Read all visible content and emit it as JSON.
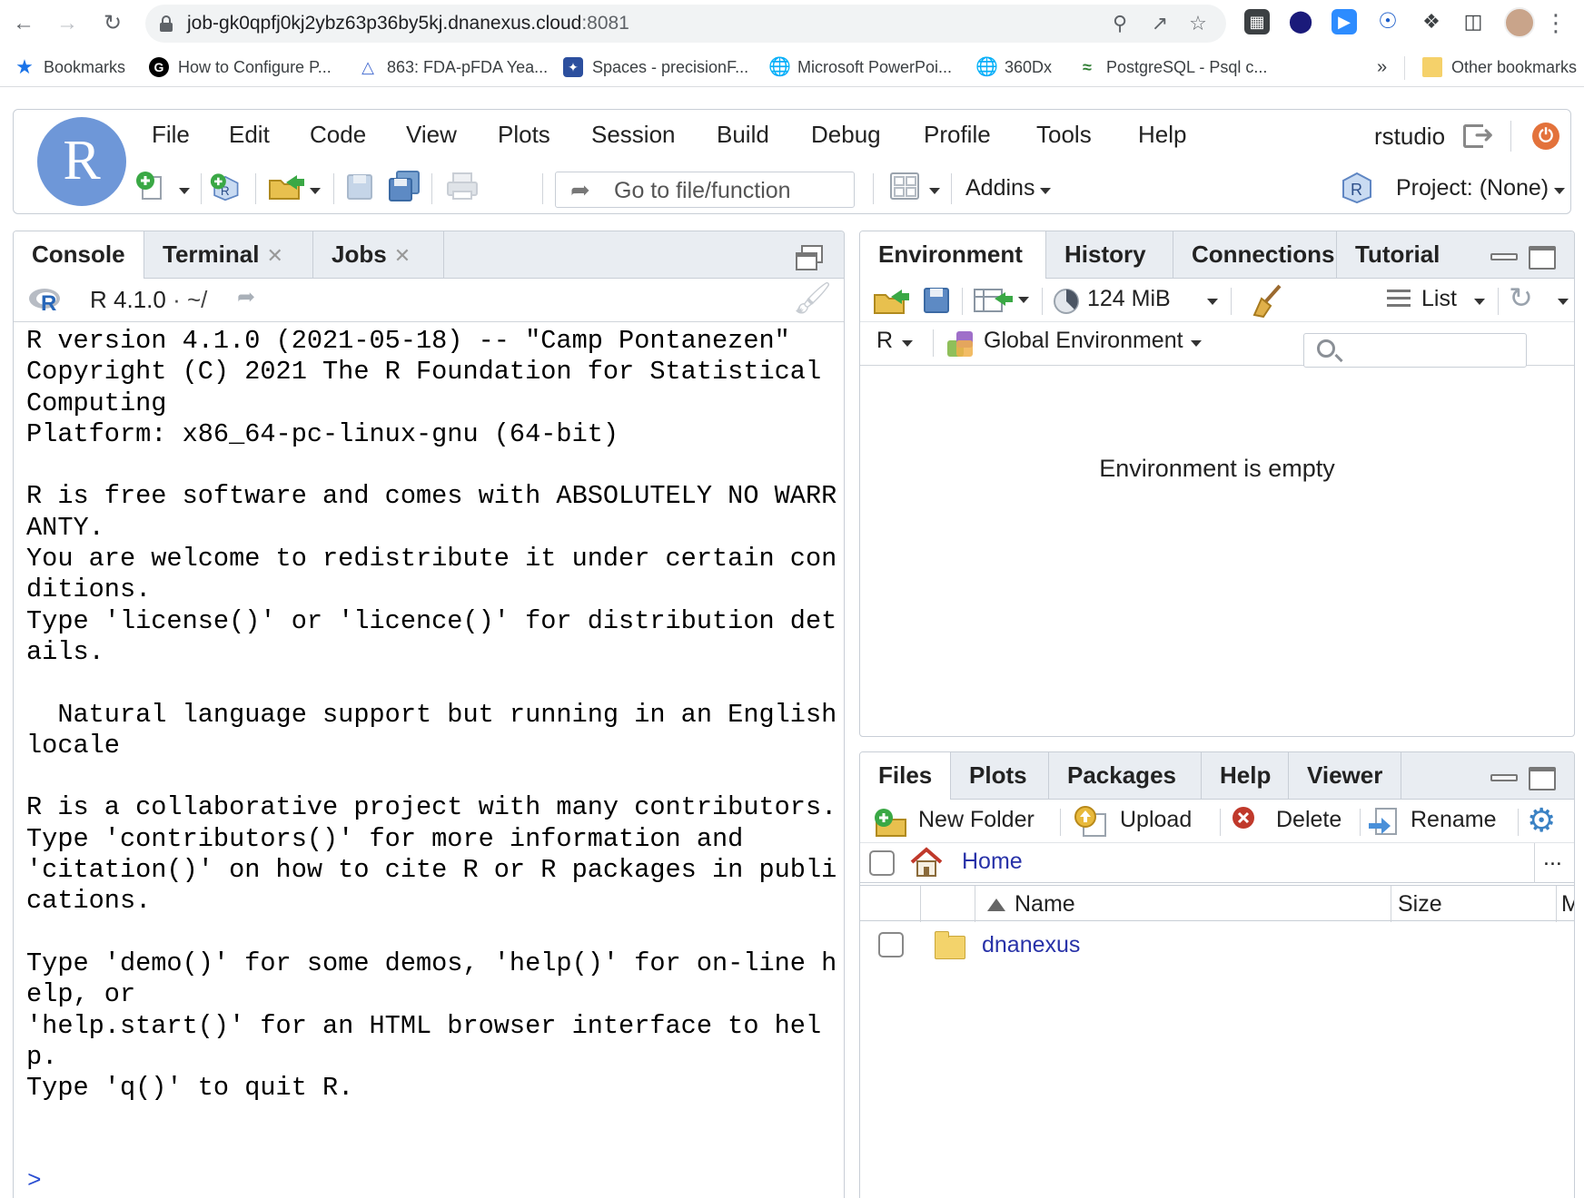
{
  "browser": {
    "url_host": "job-gk0qpfj0kj2ybz63p36by5kj.dnanexus.cloud",
    "url_port": ":8081",
    "bookmarks": [
      {
        "label": "Bookmarks",
        "icon": "star-icon",
        "color": "#1a73e8"
      },
      {
        "label": "How to Configure P...",
        "icon": "g-logo-icon",
        "color": "#000000"
      },
      {
        "label": "863: FDA-pFDA Yea...",
        "icon": "pfda-icon",
        "color": "#4a6fd1"
      },
      {
        "label": "Spaces - precisionF...",
        "icon": "spaces-icon",
        "color": "#2c4f9e"
      },
      {
        "label": "Microsoft PowerPoi...",
        "icon": "globe-icon",
        "color": "#5f6368"
      },
      {
        "label": "360Dx",
        "icon": "globe-icon",
        "color": "#5f6368"
      },
      {
        "label": "PostgreSQL - Psql c...",
        "icon": "postgres-icon",
        "color": "#2e7d32"
      }
    ],
    "overflow_label": "»",
    "other_bookmarks": "Other bookmarks"
  },
  "rstudio": {
    "logo_letter": "R",
    "menu": [
      "File",
      "Edit",
      "Code",
      "View",
      "Plots",
      "Session",
      "Build",
      "Debug",
      "Profile",
      "Tools",
      "Help"
    ],
    "user": "rstudio",
    "goto_placeholder": "Go to file/function",
    "addins_label": "Addins",
    "project_label": "Project: (None)"
  },
  "console_pane": {
    "tabs": [
      {
        "label": "Console",
        "closable": false
      },
      {
        "label": "Terminal",
        "closable": true
      },
      {
        "label": "Jobs",
        "closable": true
      }
    ],
    "r_version_label": "R 4.1.0",
    "working_dir": "· ~/",
    "output": "R version 4.1.0 (2021-05-18) -- \"Camp Pontanezen\"\nCopyright (C) 2021 The R Foundation for Statistical\nComputing\nPlatform: x86_64-pc-linux-gnu (64-bit)\n\nR is free software and comes with ABSOLUTELY NO WARR\nANTY.\nYou are welcome to redistribute it under certain con\nditions.\nType 'license()' or 'licence()' for distribution det\nails.\n\n  Natural language support but running in an English\nlocale\n\nR is a collaborative project with many contributors.\nType 'contributors()' for more information and\n'citation()' on how to cite R or R packages in publi\ncations.\n\nType 'demo()' for some demos, 'help()' for on-line h\nelp, or\n'help.start()' for an HTML browser interface to hel\np.\nType 'q()' to quit R.",
    "prompt": ">"
  },
  "env_pane": {
    "tabs": [
      "Environment",
      "History",
      "Connections",
      "Tutorial"
    ],
    "memory": "124 MiB",
    "view_mode": "List",
    "language": "R",
    "scope": "Global Environment",
    "search_placeholder": "",
    "empty_message": "Environment is empty"
  },
  "files_pane": {
    "tabs": [
      "Files",
      "Plots",
      "Packages",
      "Help",
      "Viewer"
    ],
    "toolbar": {
      "new_folder": "New Folder",
      "upload": "Upload",
      "delete": "Delete",
      "rename": "Rename"
    },
    "breadcrumb": "Home",
    "more": "...",
    "columns": {
      "name": "Name",
      "size": "Size",
      "modified": "M"
    },
    "rows": [
      {
        "name": "dnanexus",
        "type": "folder"
      }
    ]
  }
}
